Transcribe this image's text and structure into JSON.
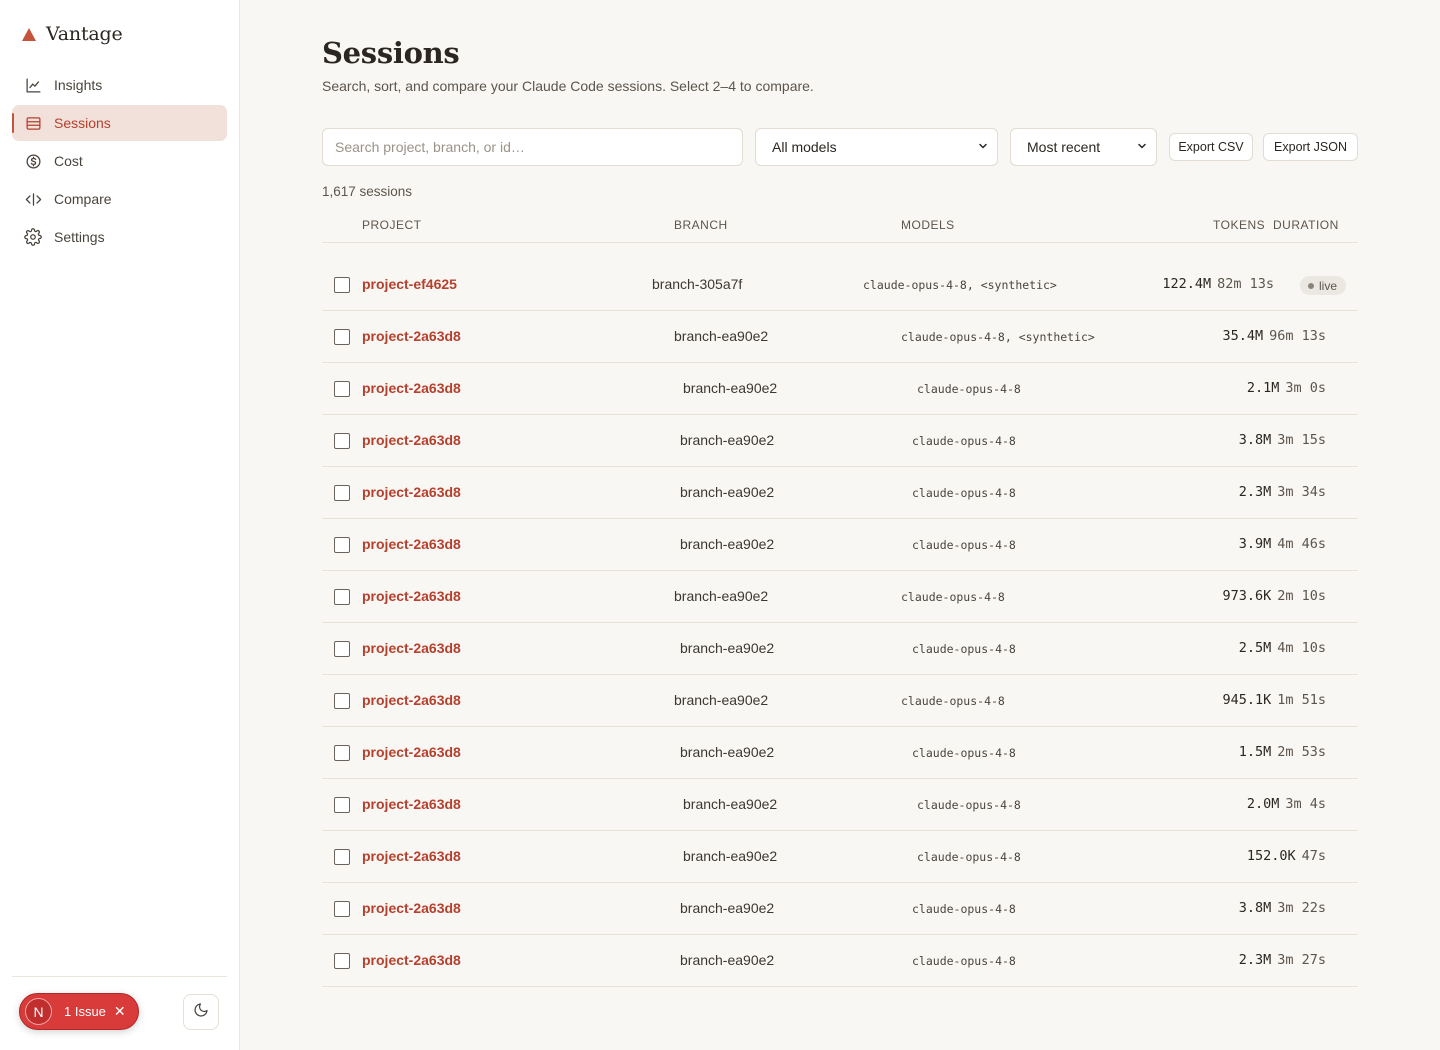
{
  "app": {
    "name": "Vantage"
  },
  "nav": {
    "items": [
      {
        "label": "Insights",
        "icon": "chart-line-icon"
      },
      {
        "label": "Sessions",
        "icon": "list-icon",
        "active": true
      },
      {
        "label": "Cost",
        "icon": "dollar-circle-icon"
      },
      {
        "label": "Compare",
        "icon": "code-compare-icon"
      },
      {
        "label": "Settings",
        "icon": "gear-icon"
      }
    ]
  },
  "issue": {
    "avatar": "N",
    "label": "1 Issue"
  },
  "page": {
    "title": "Sessions",
    "subtitle": "Search, sort, and compare your Claude Code sessions. Select 2–4 to compare."
  },
  "filters": {
    "search_placeholder": "Search project, branch, or id…",
    "models_value": "All models",
    "sort_value": "Most recent",
    "export_csv": "Export CSV",
    "export_json": "Export JSON"
  },
  "count": "1,617 sessions",
  "table": {
    "headers": {
      "project": "PROJECT",
      "branch": "BRANCH",
      "models": "MODELS",
      "tokens": "TOKENS",
      "duration": "DURATION"
    },
    "rows": [
      {
        "project": "project-ef4625",
        "branch": "branch-305a7f",
        "models": "claude-opus-4-8, <synthetic>",
        "tokens": "122.4M",
        "duration": "82m 13s",
        "badge": "live"
      },
      {
        "project": "project-2a63d8",
        "branch": "branch-ea90e2",
        "models": "claude-opus-4-8, <synthetic>",
        "tokens": "35.4M",
        "duration": "96m 13s"
      },
      {
        "project": "project-2a63d8",
        "branch": "branch-ea90e2",
        "models": "claude-opus-4-8",
        "tokens": "2.1M",
        "duration": "3m 0s"
      },
      {
        "project": "project-2a63d8",
        "branch": "branch-ea90e2",
        "models": "claude-opus-4-8",
        "tokens": "3.8M",
        "duration": "3m 15s"
      },
      {
        "project": "project-2a63d8",
        "branch": "branch-ea90e2",
        "models": "claude-opus-4-8",
        "tokens": "2.3M",
        "duration": "3m 34s"
      },
      {
        "project": "project-2a63d8",
        "branch": "branch-ea90e2",
        "models": "claude-opus-4-8",
        "tokens": "3.9M",
        "duration": "4m 46s"
      },
      {
        "project": "project-2a63d8",
        "branch": "branch-ea90e2",
        "models": "claude-opus-4-8",
        "tokens": "973.6K",
        "duration": "2m 10s"
      },
      {
        "project": "project-2a63d8",
        "branch": "branch-ea90e2",
        "models": "claude-opus-4-8",
        "tokens": "2.5M",
        "duration": "4m 10s"
      },
      {
        "project": "project-2a63d8",
        "branch": "branch-ea90e2",
        "models": "claude-opus-4-8",
        "tokens": "945.1K",
        "duration": "1m 51s"
      },
      {
        "project": "project-2a63d8",
        "branch": "branch-ea90e2",
        "models": "claude-opus-4-8",
        "tokens": "1.5M",
        "duration": "2m 53s"
      },
      {
        "project": "project-2a63d8",
        "branch": "branch-ea90e2",
        "models": "claude-opus-4-8",
        "tokens": "2.0M",
        "duration": "3m 4s"
      },
      {
        "project": "project-2a63d8",
        "branch": "branch-ea90e2",
        "models": "claude-opus-4-8",
        "tokens": "152.0K",
        "duration": "47s"
      },
      {
        "project": "project-2a63d8",
        "branch": "branch-ea90e2",
        "models": "claude-opus-4-8",
        "tokens": "3.8M",
        "duration": "3m 22s"
      },
      {
        "project": "project-2a63d8",
        "branch": "branch-ea90e2",
        "models": "claude-opus-4-8",
        "tokens": "2.3M",
        "duration": "3m 27s"
      }
    ]
  },
  "colors": {
    "accent": "#c4533e",
    "accent_text": "#b5402e",
    "active_bg": "#f1e1da",
    "issue_red": "#d93a3a"
  }
}
